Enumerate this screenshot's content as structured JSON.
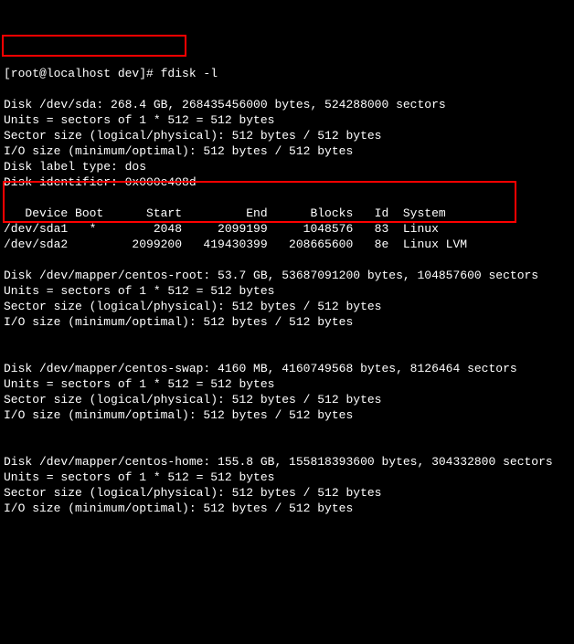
{
  "prompt": "[root@localhost dev]# fdisk -l",
  "sda": {
    "header": "Disk /dev/sda: 268.4 GB, 268435456000 bytes, 524288000 sectors",
    "units": "Units = sectors of 1 * 512 = 512 bytes",
    "sector": "Sector size (logical/physical): 512 bytes / 512 bytes",
    "io": "I/O size (minimum/optimal): 512 bytes / 512 bytes",
    "label": "Disk label type: dos",
    "ident": "Disk identifier: 0x000e408d",
    "thead": "   Device Boot      Start         End      Blocks   Id  System",
    "row1": "/dev/sda1   *        2048     2099199     1048576   83  Linux",
    "row2": "/dev/sda2         2099200   419430399   208665600   8e  Linux LVM"
  },
  "root": {
    "header": "Disk /dev/mapper/centos-root: 53.7 GB, 53687091200 bytes, 104857600 sectors",
    "units": "Units = sectors of 1 * 512 = 512 bytes",
    "sector": "Sector size (logical/physical): 512 bytes / 512 bytes",
    "io": "I/O size (minimum/optimal): 512 bytes / 512 bytes"
  },
  "swap": {
    "header": "Disk /dev/mapper/centos-swap: 4160 MB, 4160749568 bytes, 8126464 sectors",
    "units": "Units = sectors of 1 * 512 = 512 bytes",
    "sector": "Sector size (logical/physical): 512 bytes / 512 bytes",
    "io": "I/O size (minimum/optimal): 512 bytes / 512 bytes"
  },
  "home": {
    "header": "Disk /dev/mapper/centos-home: 155.8 GB, 155818393600 bytes, 304332800 sectors",
    "units": "Units = sectors of 1 * 512 = 512 bytes",
    "sector": "Sector size (logical/physical): 512 bytes / 512 bytes",
    "io": "I/O size (minimum/optimal): 512 bytes / 512 bytes"
  }
}
